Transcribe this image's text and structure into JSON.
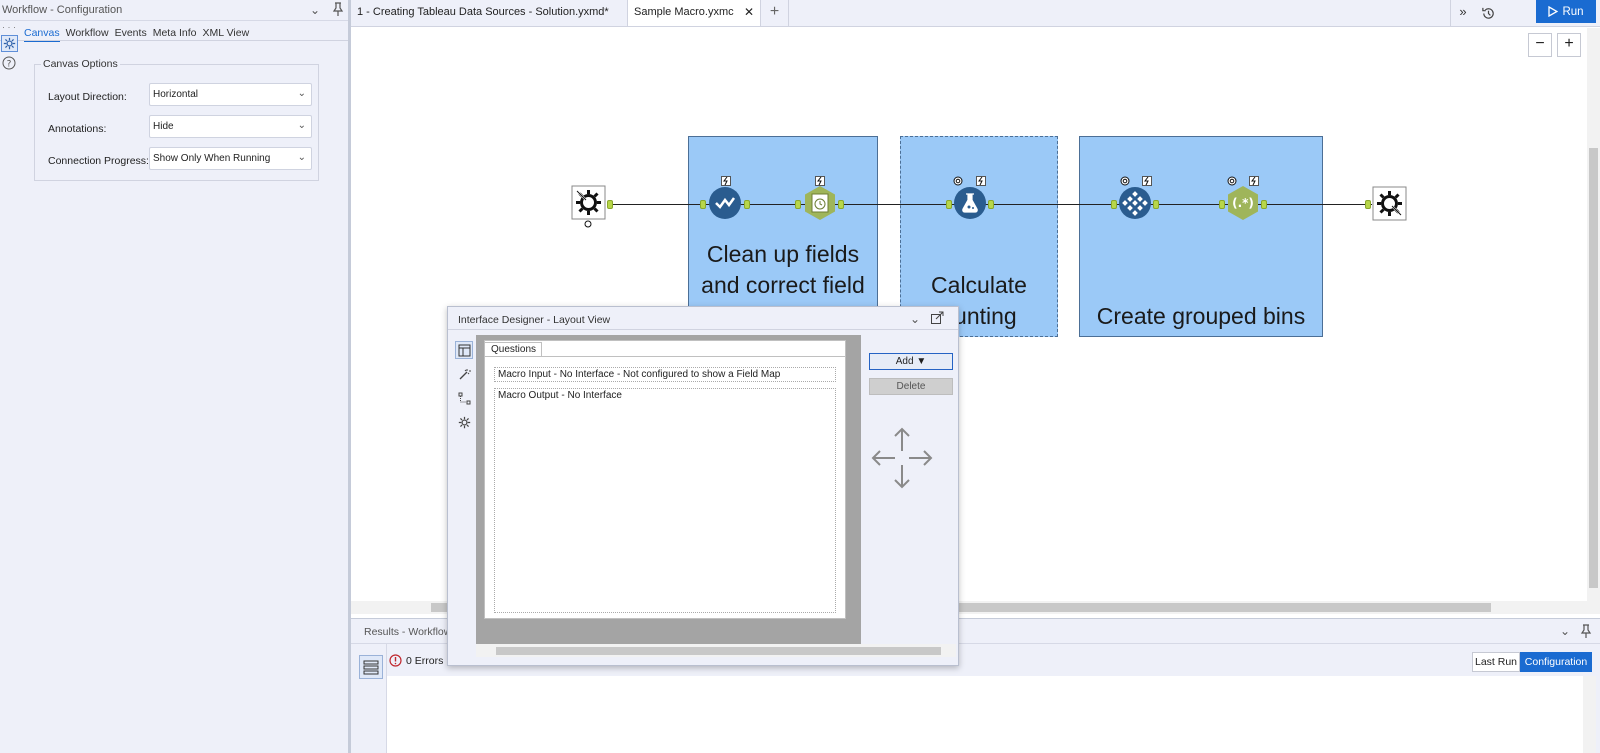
{
  "config_panel": {
    "title": "Workflow - Configuration",
    "tabs": [
      {
        "label": "Canvas",
        "active": true
      },
      {
        "label": "Workflow",
        "active": false
      },
      {
        "label": "Events",
        "active": false
      },
      {
        "label": "Meta Info",
        "active": false
      },
      {
        "label": "XML View",
        "active": false
      }
    ],
    "group_title": "Canvas Options",
    "options": [
      {
        "label": "Layout Direction:",
        "value": "Horizontal"
      },
      {
        "label": "Annotations:",
        "value": "Hide"
      },
      {
        "label": "Connection Progress:",
        "value": "Show Only When Running"
      }
    ]
  },
  "tabs": [
    {
      "label": "1 - Creating Tableau Data Sources - Solution.yxmd*"
    },
    {
      "label": "Sample Macro.yxmc",
      "active": true
    }
  ],
  "toolbar": {
    "run_label": "Run",
    "more_label": "»",
    "zoom_out": "−",
    "zoom_in": "+"
  },
  "containers": [
    {
      "text_lines": [
        "Clean up fields",
        "and correct field"
      ]
    },
    {
      "text_lines": [
        "Calculate",
        "ounting"
      ]
    },
    {
      "text_lines": [
        "Create grouped bins"
      ]
    }
  ],
  "results_panel": {
    "title": "Results - Workflow",
    "errors_label": "0 Errors",
    "last_run_label": "Last Run",
    "configuration_label": "Configuration"
  },
  "interface_designer": {
    "title": "Interface Designer - Layout View",
    "questions_tab": "Questions",
    "items": [
      "Macro Input - No Interface - Not configured to show a Field Map",
      "Macro Output - No Interface"
    ],
    "add_label": "Add ▼",
    "delete_label": "Delete"
  },
  "colors": {
    "accent": "#1a6bd1",
    "container_fill": "#9bc9f7",
    "panel_bg": "#eef0f9"
  }
}
